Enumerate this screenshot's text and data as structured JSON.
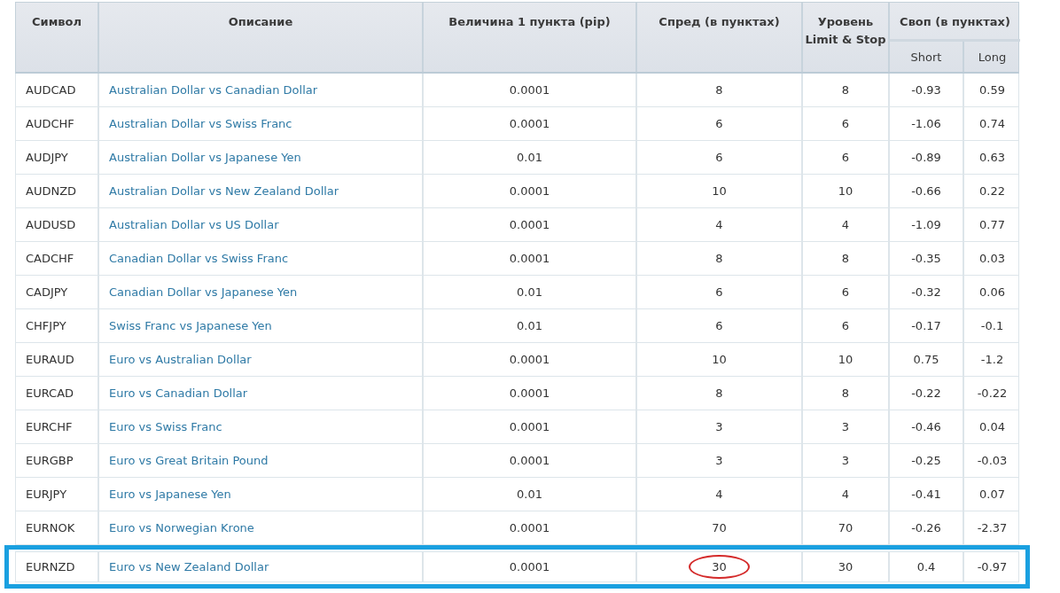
{
  "table": {
    "columns": {
      "symbol": "Символ",
      "description": "Описание",
      "pip": "Величина 1 пункта (pip)",
      "spread": "Спред (в пунктах)",
      "limit_stop": "Уровень Limit & Stop",
      "swap": "Своп (в пунктах)",
      "short": "Short",
      "long": "Long"
    },
    "rows": [
      {
        "symbol": "AUDCAD",
        "description": "Australian Dollar vs Canadian Dollar",
        "pip": "0.0001",
        "spread": "8",
        "limit_stop": "8",
        "short": "-0.93",
        "long": "0.59",
        "highlighted": false,
        "spread_circled": false
      },
      {
        "symbol": "AUDCHF",
        "description": "Australian Dollar vs Swiss Franc",
        "pip": "0.0001",
        "spread": "6",
        "limit_stop": "6",
        "short": "-1.06",
        "long": "0.74",
        "highlighted": false,
        "spread_circled": false
      },
      {
        "symbol": "AUDJPY",
        "description": "Australian Dollar vs Japanese Yen",
        "pip": "0.01",
        "spread": "6",
        "limit_stop": "6",
        "short": "-0.89",
        "long": "0.63",
        "highlighted": false,
        "spread_circled": false
      },
      {
        "symbol": "AUDNZD",
        "description": "Australian Dollar vs New Zealand Dollar",
        "pip": "0.0001",
        "spread": "10",
        "limit_stop": "10",
        "short": "-0.66",
        "long": "0.22",
        "highlighted": false,
        "spread_circled": false
      },
      {
        "symbol": "AUDUSD",
        "description": "Australian Dollar vs US Dollar",
        "pip": "0.0001",
        "spread": "4",
        "limit_stop": "4",
        "short": "-1.09",
        "long": "0.77",
        "highlighted": false,
        "spread_circled": false
      },
      {
        "symbol": "CADCHF",
        "description": "Canadian Dollar vs Swiss Franc",
        "pip": "0.0001",
        "spread": "8",
        "limit_stop": "8",
        "short": "-0.35",
        "long": "0.03",
        "highlighted": false,
        "spread_circled": false
      },
      {
        "symbol": "CADJPY",
        "description": "Canadian Dollar vs Japanese Yen",
        "pip": "0.01",
        "spread": "6",
        "limit_stop": "6",
        "short": "-0.32",
        "long": "0.06",
        "highlighted": false,
        "spread_circled": false
      },
      {
        "symbol": "CHFJPY",
        "description": "Swiss Franc vs Japanese Yen",
        "pip": "0.01",
        "spread": "6",
        "limit_stop": "6",
        "short": "-0.17",
        "long": "-0.1",
        "highlighted": false,
        "spread_circled": false
      },
      {
        "symbol": "EURAUD",
        "description": "Euro vs Australian Dollar",
        "pip": "0.0001",
        "spread": "10",
        "limit_stop": "10",
        "short": "0.75",
        "long": "-1.2",
        "highlighted": false,
        "spread_circled": false
      },
      {
        "symbol": "EURCAD",
        "description": "Euro vs Canadian Dollar",
        "pip": "0.0001",
        "spread": "8",
        "limit_stop": "8",
        "short": "-0.22",
        "long": "-0.22",
        "highlighted": false,
        "spread_circled": false
      },
      {
        "symbol": "EURCHF",
        "description": "Euro vs Swiss Franc",
        "pip": "0.0001",
        "spread": "3",
        "limit_stop": "3",
        "short": "-0.46",
        "long": "0.04",
        "highlighted": false,
        "spread_circled": false
      },
      {
        "symbol": "EURGBP",
        "description": "Euro vs Great Britain Pound",
        "pip": "0.0001",
        "spread": "3",
        "limit_stop": "3",
        "short": "-0.25",
        "long": "-0.03",
        "highlighted": false,
        "spread_circled": false
      },
      {
        "symbol": "EURJPY",
        "description": "Euro vs Japanese Yen",
        "pip": "0.01",
        "spread": "4",
        "limit_stop": "4",
        "short": "-0.41",
        "long": "0.07",
        "highlighted": false,
        "spread_circled": false
      },
      {
        "symbol": "EURNOK",
        "description": "Euro vs Norwegian Krone",
        "pip": "0.0001",
        "spread": "70",
        "limit_stop": "70",
        "short": "-0.26",
        "long": "-2.37",
        "highlighted": false,
        "spread_circled": false
      },
      {
        "symbol": "EURNZD",
        "description": "Euro vs New Zealand Dollar",
        "pip": "0.0001",
        "spread": "30",
        "limit_stop": "30",
        "short": "0.4",
        "long": "-0.97",
        "highlighted": true,
        "spread_circled": true
      }
    ]
  }
}
